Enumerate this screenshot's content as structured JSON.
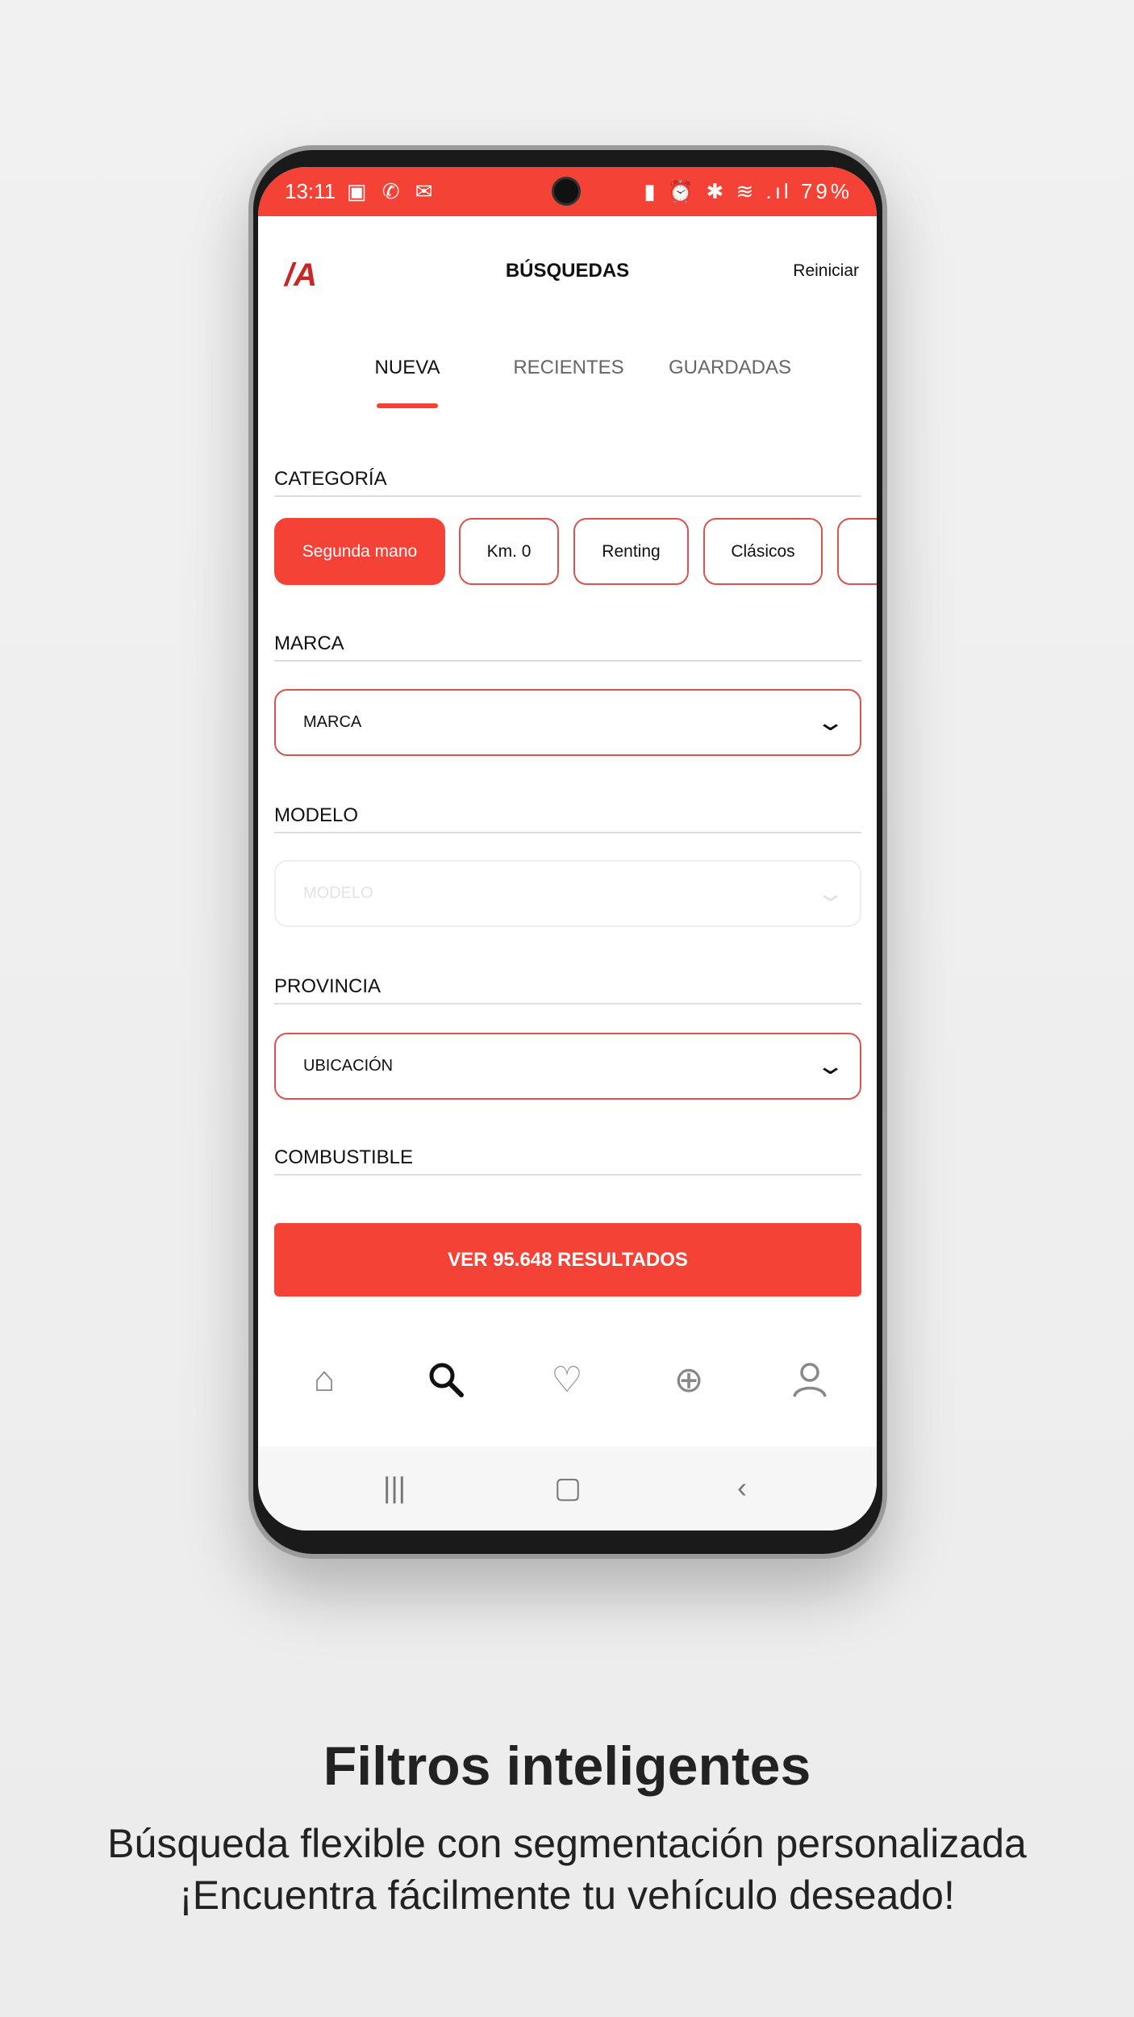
{
  "status_bar": {
    "time": "13:11",
    "left_icons": "▣ ✆ ✉",
    "right_icons": "▮ ⏰ ✱ ≋ .ıl",
    "battery": "79%"
  },
  "header": {
    "logo": "/A",
    "title": "BÚSQUEDAS",
    "reset": "Reiniciar"
  },
  "tabs": [
    {
      "label": "NUEVA",
      "active": true
    },
    {
      "label": "RECIENTES"
    },
    {
      "label": "GUARDADAS"
    }
  ],
  "sections": {
    "category": "CATEGORÍA",
    "brand": "MARCA",
    "model": "MODELO",
    "province": "PROVINCIA",
    "fuel": "COMBUSTIBLE"
  },
  "chips": [
    {
      "label": "Segunda mano",
      "active": true
    },
    {
      "label": "Km. 0"
    },
    {
      "label": "Renting"
    },
    {
      "label": "Clásicos"
    },
    {
      "label": ""
    }
  ],
  "selects": {
    "brand": "MARCA",
    "model": "MODELO",
    "province": "UBICACIÓN"
  },
  "cta": "VER 95.648 RESULTADOS",
  "bottom_nav": [
    "home-icon",
    "search-icon",
    "heart-icon",
    "plus-circle-icon",
    "user-icon"
  ],
  "accent": "#f44336",
  "caption": {
    "title": "Filtros inteligentes",
    "line1": "Búsqueda flexible con segmentación personalizada",
    "line2": "¡Encuentra fácilmente tu vehículo deseado!"
  }
}
